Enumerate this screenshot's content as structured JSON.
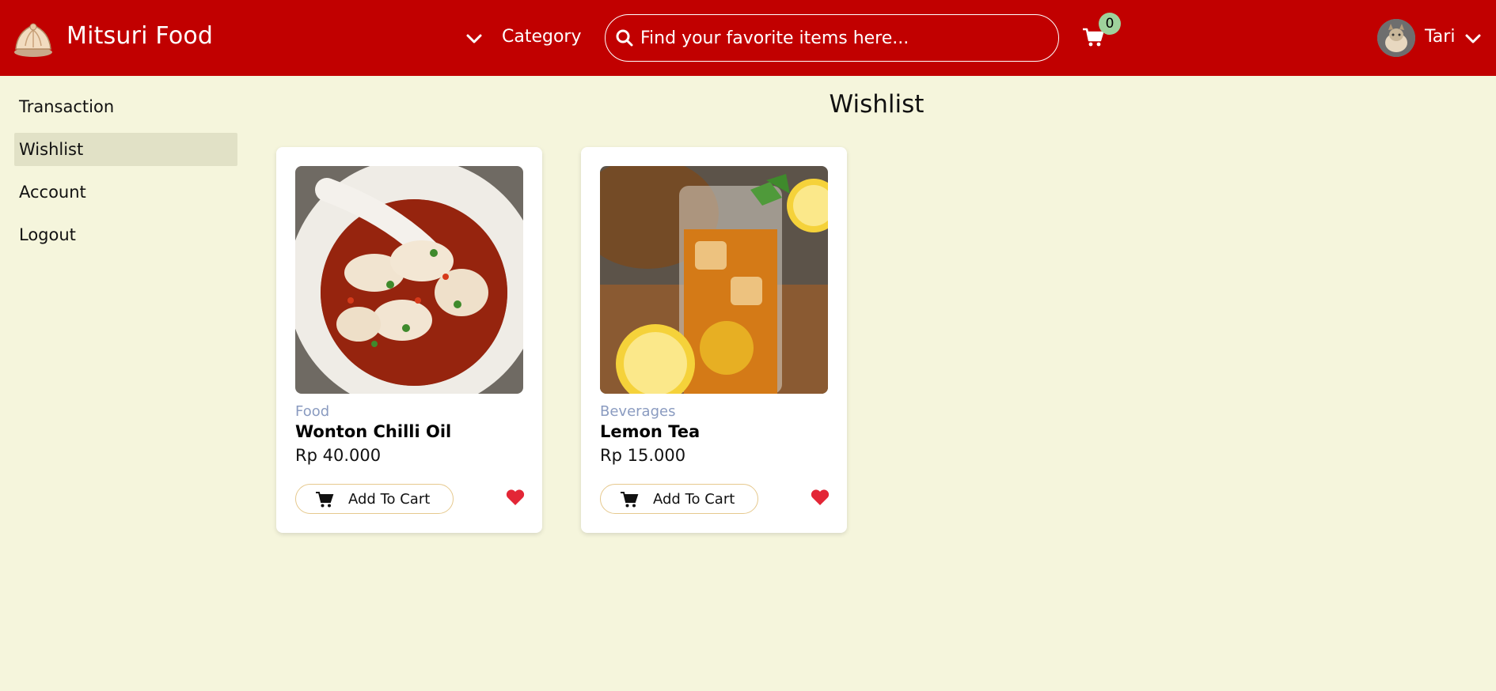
{
  "header": {
    "brand": "Mitsuri Food",
    "category_label": "Category",
    "search_placeholder": "Find your favorite items here...",
    "cart_count": "0",
    "user_name": "Tari",
    "bg_color": "#c10000"
  },
  "sidebar": {
    "items": [
      {
        "label": "Transaction"
      },
      {
        "label": "Wishlist",
        "active": true
      },
      {
        "label": "Account"
      },
      {
        "label": "Logout"
      }
    ]
  },
  "main": {
    "title": "Wishlist",
    "products": [
      {
        "category": "Food",
        "name": "Wonton Chilli Oil",
        "price": "Rp 40.000",
        "button_label": "Add To Cart",
        "image": "wonton-dumplings-in-chilli-oil"
      },
      {
        "category": "Beverages",
        "name": "Lemon Tea",
        "price": "Rp 15.000",
        "button_label": "Add To Cart",
        "image": "iced-lemon-tea-glass"
      }
    ]
  },
  "colors": {
    "background": "#f5f5dc",
    "header": "#c10000",
    "badge": "#9ed29c",
    "heart": "#e32636",
    "active_sidebar": "#e1e1c6"
  }
}
